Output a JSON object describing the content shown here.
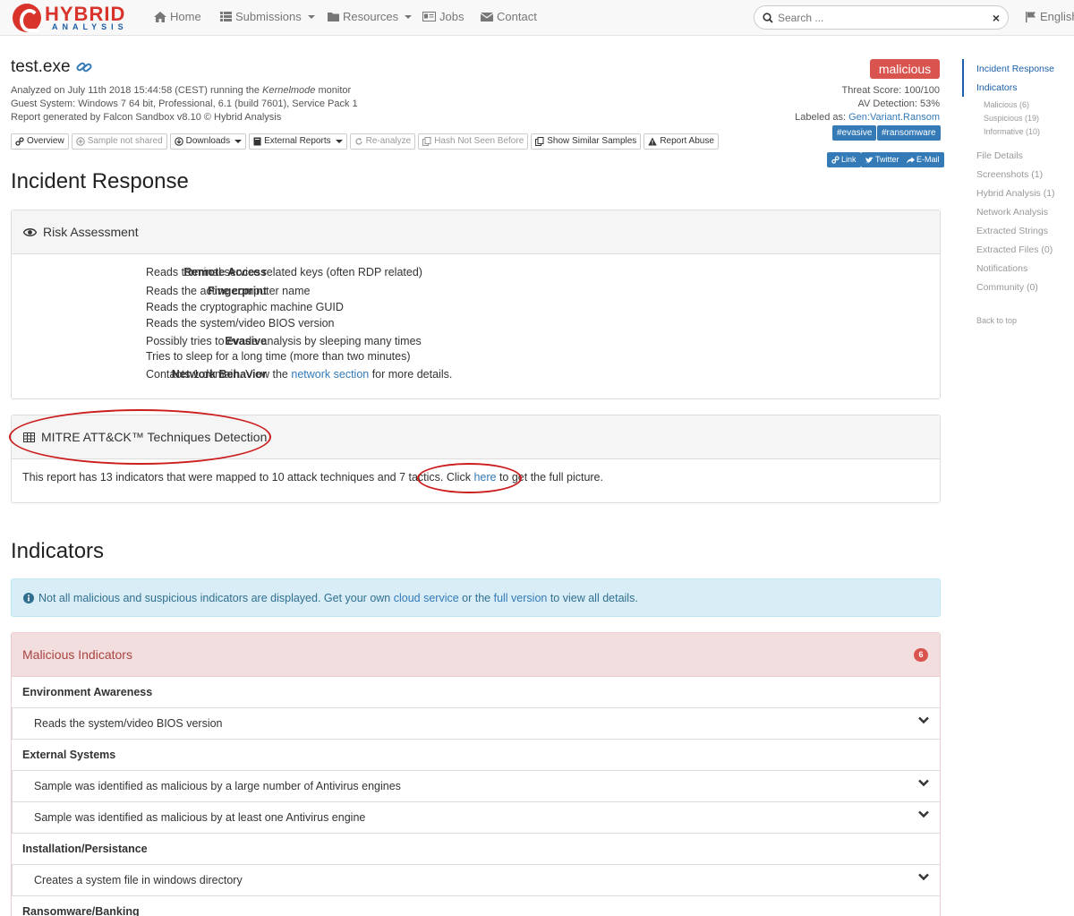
{
  "nav": {
    "logo_main": "HYBRID",
    "logo_sub": "ANALYSIS",
    "home": "Home",
    "submissions": "Submissions",
    "resources": "Resources",
    "jobs": "Jobs",
    "contact": "Contact",
    "search_placeholder": "Search ...",
    "clear": "×",
    "language": "English"
  },
  "header": {
    "file_name": "test.exe",
    "analyzed_prefix": "Analyzed on July 11th 2018 15:44:58 (CEST) running the ",
    "analyzed_mode": "Kernelmode",
    "analyzed_suffix": " monitor",
    "guest_system": "Guest System: Windows 7 64 bit, Professional, 6.1 (build 7601), Service Pack 1",
    "report_generated": "Report generated by Falcon Sandbox v8.10 © Hybrid Analysis",
    "actions": {
      "overview": "Overview",
      "sample_not_shared": "Sample not shared",
      "downloads": "Downloads",
      "external_reports": "External Reports",
      "re_analyze": "Re-analyze",
      "hash_not_seen": "Hash Not Seen Before",
      "show_similar": "Show Similar Samples",
      "report_abuse": "Report Abuse"
    },
    "verdict": "malicious",
    "threat_score": "Threat Score: 100/100",
    "av_detection": "AV Detection: 53%",
    "labeled_as_prefix": "Labeled as: ",
    "labeled_as_value": "Gen:Variant.Ransom",
    "tags": [
      "#evasive",
      "#ransomware"
    ],
    "share": {
      "link": "Link",
      "twitter": "Twitter",
      "email": "E-Mail"
    }
  },
  "incident_response": {
    "title": "Incident Response",
    "risk_title": "Risk Assessment",
    "rows": [
      {
        "label": "Remote Access",
        "lines": [
          "Reads terminal service related keys (often RDP related)"
        ]
      },
      {
        "label": "Fingerprint",
        "lines": [
          "Reads the active computer name",
          "Reads the cryptographic machine GUID",
          "Reads the system/video BIOS version"
        ]
      },
      {
        "label": "Evasive",
        "lines": [
          "Possibly tries to evade analysis by sleeping many times",
          "Tries to sleep for a long time (more than two minutes)"
        ]
      },
      {
        "label": "Network Behavior",
        "prefix": "Contacts 1 domain. View the ",
        "link": "network section",
        "suffix": " for more details."
      }
    ]
  },
  "mitre": {
    "title": "MITRE ATT&CK™ Techniques Detection",
    "text_prefix": "This report has 13 indicators that were mapped to 10 attack techniques and 7 tactics. Click ",
    "link": "here",
    "text_suffix": " to get the full picture."
  },
  "indicators": {
    "title": "Indicators",
    "alert_prefix": "Not all malicious and suspicious indicators are displayed. Get your own ",
    "alert_link1": "cloud service",
    "alert_mid": " or the ",
    "alert_link2": "full version",
    "alert_suffix": " to view all details.",
    "malicious_title": "Malicious Indicators",
    "malicious_count": "6",
    "categories": [
      {
        "name": "Environment Awareness",
        "items": [
          "Reads the system/video BIOS version"
        ]
      },
      {
        "name": "External Systems",
        "items": [
          "Sample was identified as malicious by a large number of Antivirus engines",
          "Sample was identified as malicious by at least one Antivirus engine"
        ]
      },
      {
        "name": "Installation/Persistance",
        "items": [
          "Creates a system file in windows directory"
        ]
      },
      {
        "name": "Ransomware/Banking",
        "items": []
      }
    ]
  },
  "sidebar": {
    "incident_response": "Incident Response",
    "indicators": "Indicators",
    "malicious": "Malicious (6)",
    "suspicious": "Suspicious (19)",
    "informative": "Informative (10)",
    "file_details": "File Details",
    "screenshots": "Screenshots (1)",
    "hybrid_analysis": "Hybrid Analysis (1)",
    "network_analysis": "Network Analysis",
    "extracted_strings": "Extracted Strings",
    "extracted_files": "Extracted Files (0)",
    "notifications": "Notifications",
    "community": "Community (0)",
    "back_to_top": "Back to top"
  },
  "colors": {
    "brand_red": "#d9342b",
    "brand_blue": "#1b5fa8",
    "link": "#337ab7",
    "danger": "#d9534f",
    "annotation": "#cc1e1e"
  }
}
